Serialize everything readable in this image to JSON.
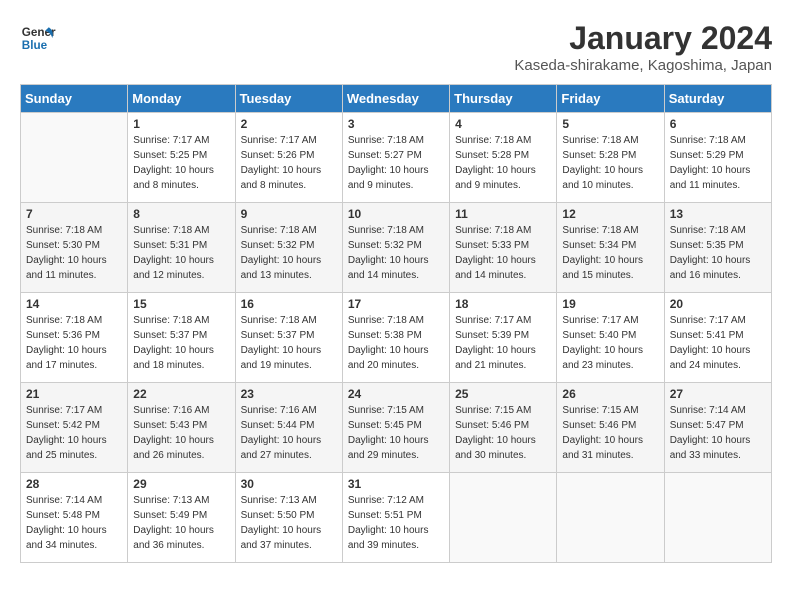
{
  "header": {
    "logo_line1": "General",
    "logo_line2": "Blue",
    "title": "January 2024",
    "location": "Kaseda-shirakame, Kagoshima, Japan"
  },
  "weekdays": [
    "Sunday",
    "Monday",
    "Tuesday",
    "Wednesday",
    "Thursday",
    "Friday",
    "Saturday"
  ],
  "weeks": [
    [
      {
        "day": "",
        "sunrise": "",
        "sunset": "",
        "daylight": ""
      },
      {
        "day": "1",
        "sunrise": "Sunrise: 7:17 AM",
        "sunset": "Sunset: 5:25 PM",
        "daylight": "Daylight: 10 hours and 8 minutes."
      },
      {
        "day": "2",
        "sunrise": "Sunrise: 7:17 AM",
        "sunset": "Sunset: 5:26 PM",
        "daylight": "Daylight: 10 hours and 8 minutes."
      },
      {
        "day": "3",
        "sunrise": "Sunrise: 7:18 AM",
        "sunset": "Sunset: 5:27 PM",
        "daylight": "Daylight: 10 hours and 9 minutes."
      },
      {
        "day": "4",
        "sunrise": "Sunrise: 7:18 AM",
        "sunset": "Sunset: 5:28 PM",
        "daylight": "Daylight: 10 hours and 9 minutes."
      },
      {
        "day": "5",
        "sunrise": "Sunrise: 7:18 AM",
        "sunset": "Sunset: 5:28 PM",
        "daylight": "Daylight: 10 hours and 10 minutes."
      },
      {
        "day": "6",
        "sunrise": "Sunrise: 7:18 AM",
        "sunset": "Sunset: 5:29 PM",
        "daylight": "Daylight: 10 hours and 11 minutes."
      }
    ],
    [
      {
        "day": "7",
        "sunrise": "Sunrise: 7:18 AM",
        "sunset": "Sunset: 5:30 PM",
        "daylight": "Daylight: 10 hours and 11 minutes."
      },
      {
        "day": "8",
        "sunrise": "Sunrise: 7:18 AM",
        "sunset": "Sunset: 5:31 PM",
        "daylight": "Daylight: 10 hours and 12 minutes."
      },
      {
        "day": "9",
        "sunrise": "Sunrise: 7:18 AM",
        "sunset": "Sunset: 5:32 PM",
        "daylight": "Daylight: 10 hours and 13 minutes."
      },
      {
        "day": "10",
        "sunrise": "Sunrise: 7:18 AM",
        "sunset": "Sunset: 5:32 PM",
        "daylight": "Daylight: 10 hours and 14 minutes."
      },
      {
        "day": "11",
        "sunrise": "Sunrise: 7:18 AM",
        "sunset": "Sunset: 5:33 PM",
        "daylight": "Daylight: 10 hours and 14 minutes."
      },
      {
        "day": "12",
        "sunrise": "Sunrise: 7:18 AM",
        "sunset": "Sunset: 5:34 PM",
        "daylight": "Daylight: 10 hours and 15 minutes."
      },
      {
        "day": "13",
        "sunrise": "Sunrise: 7:18 AM",
        "sunset": "Sunset: 5:35 PM",
        "daylight": "Daylight: 10 hours and 16 minutes."
      }
    ],
    [
      {
        "day": "14",
        "sunrise": "Sunrise: 7:18 AM",
        "sunset": "Sunset: 5:36 PM",
        "daylight": "Daylight: 10 hours and 17 minutes."
      },
      {
        "day": "15",
        "sunrise": "Sunrise: 7:18 AM",
        "sunset": "Sunset: 5:37 PM",
        "daylight": "Daylight: 10 hours and 18 minutes."
      },
      {
        "day": "16",
        "sunrise": "Sunrise: 7:18 AM",
        "sunset": "Sunset: 5:37 PM",
        "daylight": "Daylight: 10 hours and 19 minutes."
      },
      {
        "day": "17",
        "sunrise": "Sunrise: 7:18 AM",
        "sunset": "Sunset: 5:38 PM",
        "daylight": "Daylight: 10 hours and 20 minutes."
      },
      {
        "day": "18",
        "sunrise": "Sunrise: 7:17 AM",
        "sunset": "Sunset: 5:39 PM",
        "daylight": "Daylight: 10 hours and 21 minutes."
      },
      {
        "day": "19",
        "sunrise": "Sunrise: 7:17 AM",
        "sunset": "Sunset: 5:40 PM",
        "daylight": "Daylight: 10 hours and 23 minutes."
      },
      {
        "day": "20",
        "sunrise": "Sunrise: 7:17 AM",
        "sunset": "Sunset: 5:41 PM",
        "daylight": "Daylight: 10 hours and 24 minutes."
      }
    ],
    [
      {
        "day": "21",
        "sunrise": "Sunrise: 7:17 AM",
        "sunset": "Sunset: 5:42 PM",
        "daylight": "Daylight: 10 hours and 25 minutes."
      },
      {
        "day": "22",
        "sunrise": "Sunrise: 7:16 AM",
        "sunset": "Sunset: 5:43 PM",
        "daylight": "Daylight: 10 hours and 26 minutes."
      },
      {
        "day": "23",
        "sunrise": "Sunrise: 7:16 AM",
        "sunset": "Sunset: 5:44 PM",
        "daylight": "Daylight: 10 hours and 27 minutes."
      },
      {
        "day": "24",
        "sunrise": "Sunrise: 7:15 AM",
        "sunset": "Sunset: 5:45 PM",
        "daylight": "Daylight: 10 hours and 29 minutes."
      },
      {
        "day": "25",
        "sunrise": "Sunrise: 7:15 AM",
        "sunset": "Sunset: 5:46 PM",
        "daylight": "Daylight: 10 hours and 30 minutes."
      },
      {
        "day": "26",
        "sunrise": "Sunrise: 7:15 AM",
        "sunset": "Sunset: 5:46 PM",
        "daylight": "Daylight: 10 hours and 31 minutes."
      },
      {
        "day": "27",
        "sunrise": "Sunrise: 7:14 AM",
        "sunset": "Sunset: 5:47 PM",
        "daylight": "Daylight: 10 hours and 33 minutes."
      }
    ],
    [
      {
        "day": "28",
        "sunrise": "Sunrise: 7:14 AM",
        "sunset": "Sunset: 5:48 PM",
        "daylight": "Daylight: 10 hours and 34 minutes."
      },
      {
        "day": "29",
        "sunrise": "Sunrise: 7:13 AM",
        "sunset": "Sunset: 5:49 PM",
        "daylight": "Daylight: 10 hours and 36 minutes."
      },
      {
        "day": "30",
        "sunrise": "Sunrise: 7:13 AM",
        "sunset": "Sunset: 5:50 PM",
        "daylight": "Daylight: 10 hours and 37 minutes."
      },
      {
        "day": "31",
        "sunrise": "Sunrise: 7:12 AM",
        "sunset": "Sunset: 5:51 PM",
        "daylight": "Daylight: 10 hours and 39 minutes."
      },
      {
        "day": "",
        "sunrise": "",
        "sunset": "",
        "daylight": ""
      },
      {
        "day": "",
        "sunrise": "",
        "sunset": "",
        "daylight": ""
      },
      {
        "day": "",
        "sunrise": "",
        "sunset": "",
        "daylight": ""
      }
    ]
  ]
}
